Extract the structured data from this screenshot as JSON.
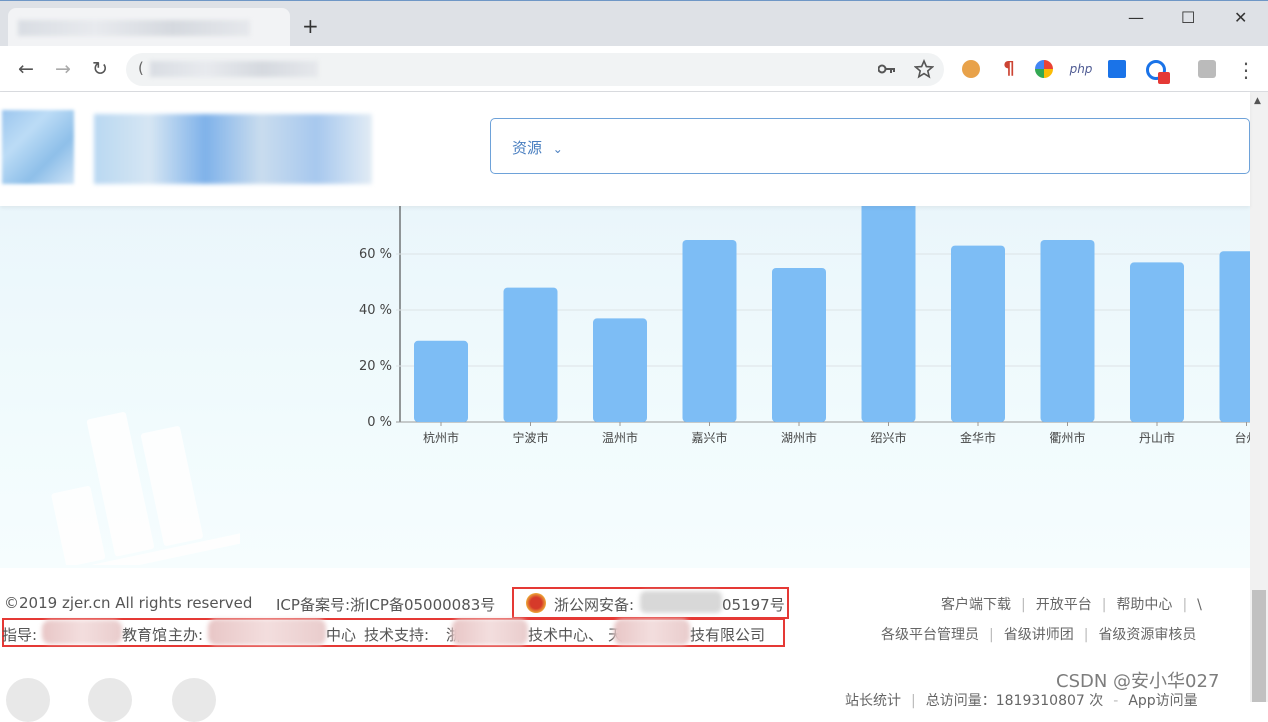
{
  "browser": {
    "new_tab": "+",
    "window_controls": {
      "minimize": "—",
      "maximize": "☐",
      "close": "✕"
    },
    "nav": {
      "back": "←",
      "forward": "→",
      "reload": "↻"
    },
    "omnibox_prefix": "(",
    "extensions": [
      "key-icon",
      "star-icon",
      "cookie-extension-icon",
      "pilcrow-extension-icon",
      "color-ring-extension-icon",
      "php-extension-icon",
      "doc-extension-icon",
      "cast-extension-icon",
      "profile-icon",
      "menu-icon"
    ],
    "php_label": "php",
    "pilcrow": "¶",
    "menu_glyph": "⋮"
  },
  "header": {
    "search_select_label": "资源",
    "search_select_caret": "⌄"
  },
  "chart_data": {
    "type": "bar",
    "categories": [
      "杭州市",
      "宁波市",
      "温州市",
      "嘉兴市",
      "湖州市",
      "绍兴市",
      "金华市",
      "衢州市",
      "丹山市",
      "台州"
    ],
    "values": [
      29,
      48,
      37,
      65,
      55,
      80,
      63,
      65,
      57,
      61
    ],
    "y_ticks": [
      "0 %",
      "20 %",
      "40 %",
      "60 %"
    ],
    "ylim": [
      0,
      80
    ],
    "bar_color": "#7dbdf5",
    "grid": true
  },
  "footer": {
    "copyright": "©2019 zjer.cn All rights reserved",
    "icp": "ICP备案号:浙ICP备05000083号",
    "police_prefix": "浙公网安备:",
    "police_suffix": "05197号",
    "guide_prefix": "指导:",
    "guide_org": "教育馆",
    "host_prefix": "主办:",
    "host_org_suffix": "中心",
    "tech_prefix": "技术支持:",
    "tech_org1_suffix": "技术中心、",
    "tech_org2_suffix": "技有限公司",
    "tech_org2_char": "天",
    "tech_org1_char": "浙",
    "links_row1": [
      "客户端下载",
      "开放平台",
      "帮助中心",
      "\\"
    ],
    "links_row2": [
      "各级平台管理员",
      "省级讲师团",
      "省级资源审核员"
    ],
    "stats_label": "站长统计",
    "total_visits": "总访问量：1819310807 次",
    "app_visits": "App访问量"
  },
  "watermark": "CSDN @安小华027",
  "colors": {
    "accent": "#4a7fc0",
    "bar": "#7dbdf5",
    "highlight_box": "#e53935"
  }
}
